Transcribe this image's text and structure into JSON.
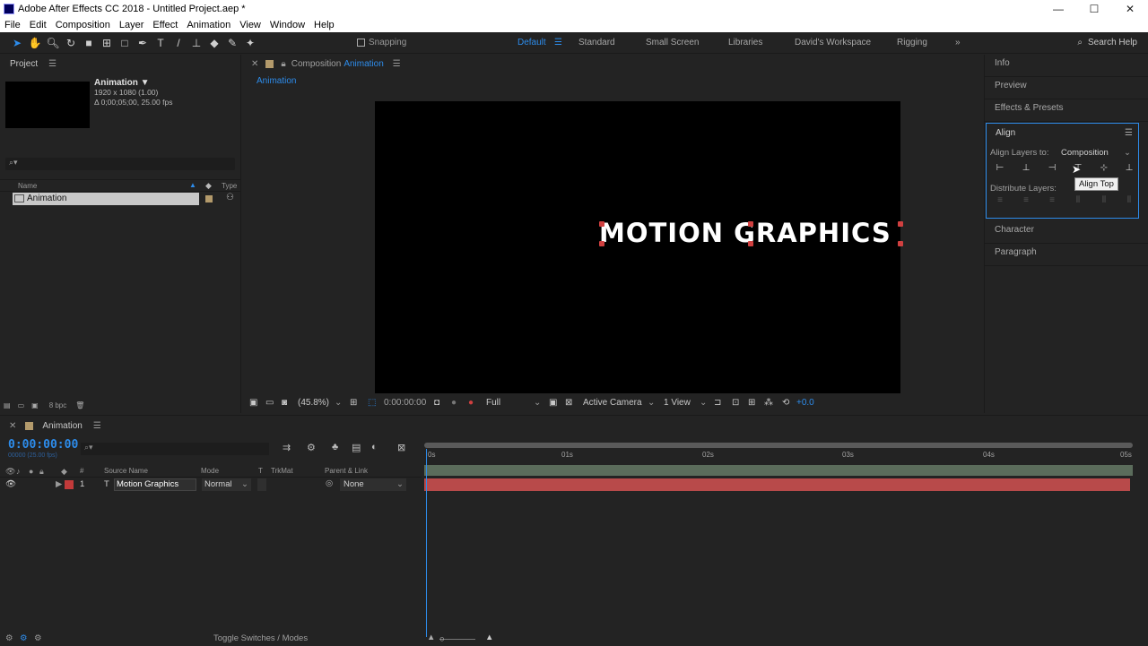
{
  "window": {
    "title": "Adobe After Effects CC 2018 - Untitled Project.aep *",
    "minimize": "—",
    "maximize": "☐",
    "close": "✕"
  },
  "menu": [
    "File",
    "Edit",
    "Composition",
    "Layer",
    "Effect",
    "Animation",
    "View",
    "Window",
    "Help"
  ],
  "toolbar": {
    "snapping_label": "Snapping",
    "workspaces": [
      "Default",
      "Standard",
      "Small Screen",
      "Libraries",
      "David's Workspace",
      "Rigging"
    ],
    "active_workspace": "Default",
    "search_help": "Search Help"
  },
  "project": {
    "tab_label": "Project",
    "item_name": "Animation ▼",
    "item_res": "1920 x 1080 (1.00)",
    "item_dur": "Δ 0;00;05;00, 25.00 fps",
    "search_icon": "⌕▾",
    "col_name": "Name",
    "col_type": "Type",
    "rows": [
      {
        "name": "Animation"
      }
    ],
    "bpc": "8 bpc"
  },
  "composition": {
    "tab_prefix": "Composition",
    "tab_name": "Animation",
    "sub_tab": "Animation",
    "canvas_text": "MOTION GRAPHICS",
    "zoom": "(45.8%)",
    "timecode": "0:00:00:00",
    "resolution": "Full",
    "camera": "Active Camera",
    "views": "1 View",
    "exposure": "+0.0"
  },
  "right_panels": {
    "info": "Info",
    "preview": "Preview",
    "effects": "Effects & Presets",
    "align_title": "Align",
    "align_layers_to_label": "Align Layers to:",
    "align_layers_to_value": "Composition",
    "distribute_label": "Distribute Layers:",
    "tooltip": "Align Top",
    "character": "Character",
    "paragraph": "Paragraph"
  },
  "timeline": {
    "tab_label": "Animation",
    "time": "0:00:00:00",
    "fps": "00000 (25.00 fps)",
    "search_icon": "⌕▾",
    "col_source": "Source Name",
    "col_mode": "Mode",
    "col_t": "T",
    "col_trkmat": "TrkMat",
    "col_parent": "Parent & Link",
    "layer": {
      "number": "1",
      "type": "T",
      "name": "Motion Graphics",
      "mode": "Normal",
      "parent": "None"
    },
    "ticks": [
      "0s",
      "01s",
      "02s",
      "03s",
      "04s",
      "05s"
    ],
    "toggle_label": "Toggle Switches / Modes"
  }
}
